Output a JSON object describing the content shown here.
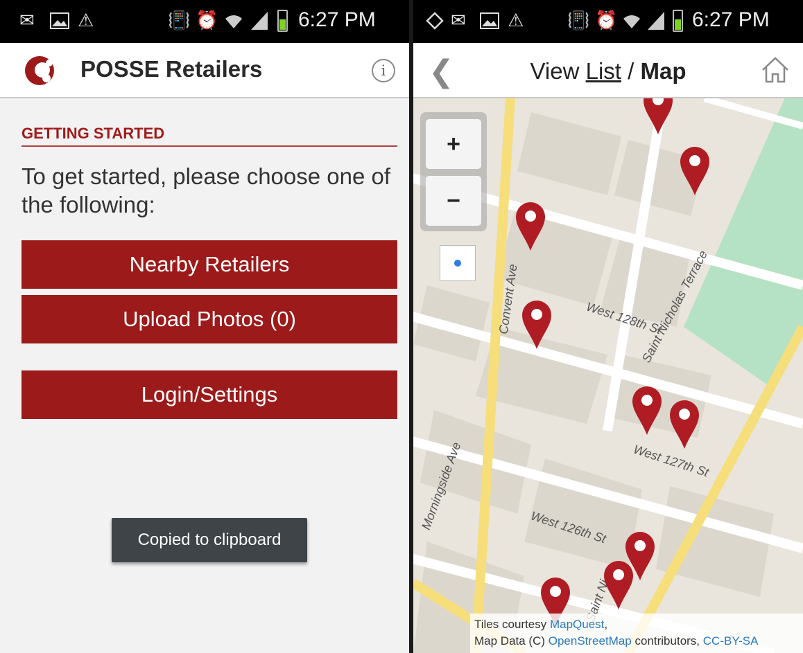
{
  "status_bar": {
    "time": "6:27 PM",
    "icons": [
      "mail-icon",
      "image-icon",
      "warning-icon",
      "vibrate-icon",
      "alarm-icon",
      "wifi-icon",
      "signal-icon",
      "battery-icon"
    ],
    "right_icons": [
      "gps-icon",
      "mail-icon",
      "image-icon",
      "warning-icon",
      "vibrate-icon",
      "alarm-icon",
      "wifi-icon",
      "signal-icon",
      "battery-icon"
    ]
  },
  "left": {
    "app_title": "POSSE Retailers",
    "section_heading": "GETTING STARTED",
    "intro": "To get started, please choose one of the following:",
    "buttons": {
      "nearby": "Nearby Retailers",
      "upload": "Upload Photos (0)",
      "login": "Login/Settings"
    },
    "toast": "Copied to clipboard",
    "colors": {
      "accent": "#9c1a1a",
      "heading": "#9e1b1b"
    }
  },
  "right": {
    "title_view": "View",
    "title_list": "List",
    "title_sep": " / ",
    "title_map": "Map",
    "zoom_in": "+",
    "zoom_out": "−",
    "streets": {
      "convent": "Convent Ave",
      "w128": "West 128th St",
      "st_nicholas": "Saint Nicholas Terrace",
      "w127": "West 127th St",
      "morningside": "Morningside Ave",
      "w126": "West 126th St",
      "st_nich_ave": "Saint Ni..."
    },
    "attribution": {
      "line1_prefix": "Tiles courtesy ",
      "line1_link": "MapQuest",
      "line1_suffix": ",",
      "line2_prefix": "Map Data (C) ",
      "line2_link": "OpenStreetMap",
      "line2_mid": " contributors, ",
      "line2_link2": "CC-BY-SA"
    },
    "pin_count": 9,
    "colors": {
      "pin": "#b01c24",
      "park": "#b5e2c4",
      "avenue": "#f6de7a"
    }
  }
}
